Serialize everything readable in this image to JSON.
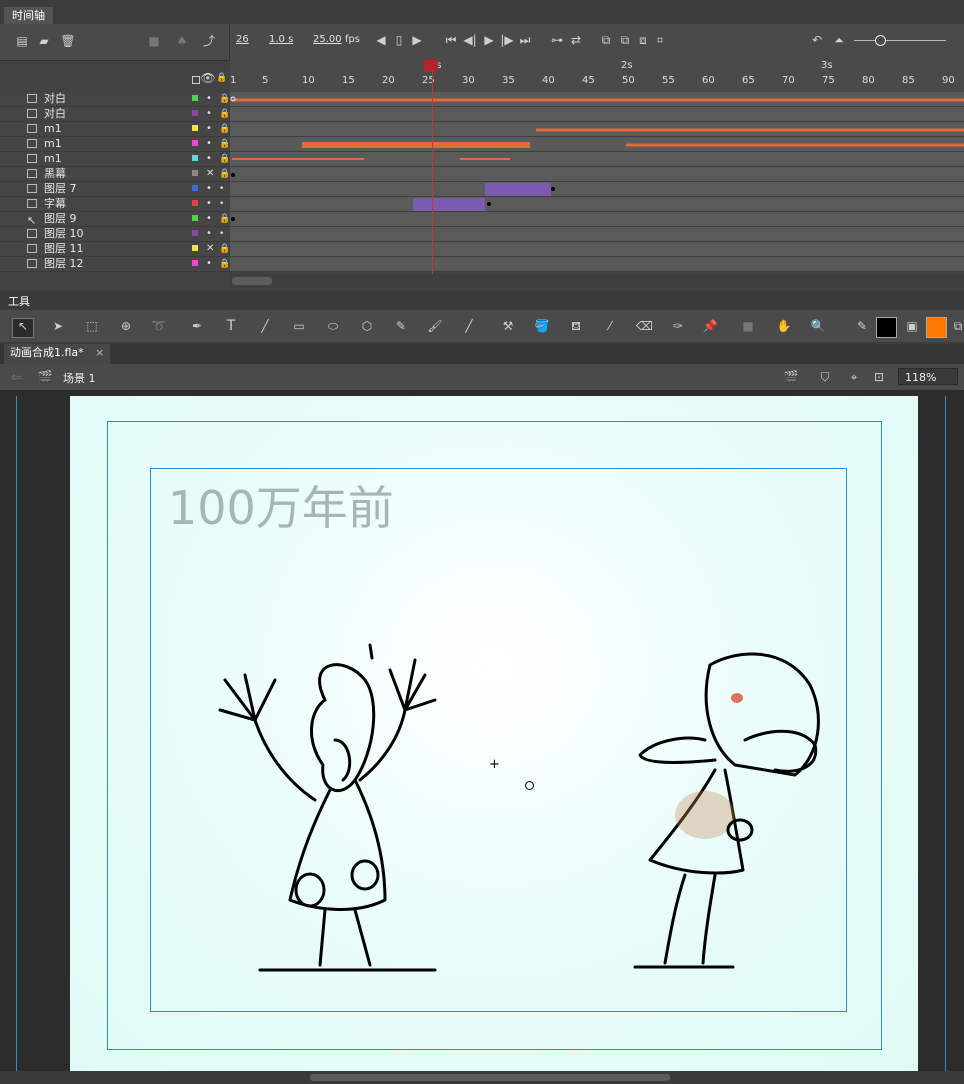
{
  "timeline": {
    "panel_title": "时间轴",
    "current_frame": "26",
    "elapsed": "1.0 s",
    "fps_value": "25.00",
    "fps_unit": "fps",
    "ruler_ticks": [
      "1",
      "5",
      "10",
      "15",
      "20",
      "25",
      "30",
      "35",
      "40",
      "45",
      "50",
      "55",
      "60",
      "65",
      "70",
      "75",
      "80",
      "85",
      "90"
    ],
    "seconds_marks": [
      "1s",
      "2s",
      "3s"
    ],
    "layers": [
      {
        "name": "对白",
        "color": "#4cd44c",
        "visible": "•",
        "lock": "🔒"
      },
      {
        "name": "对白",
        "color": "#8e44ad",
        "visible": "•",
        "lock": "🔒"
      },
      {
        "name": "m1",
        "color": "#f1e44a",
        "visible": "•",
        "lock": "🔒"
      },
      {
        "name": "m1",
        "color": "#e84ad4",
        "visible": "•",
        "lock": "🔒"
      },
      {
        "name": "m1",
        "color": "#4ae0e0",
        "visible": "•",
        "lock": "🔒"
      },
      {
        "name": "黑幕",
        "color": "#888888",
        "visible": "✕",
        "lock": "🔒"
      },
      {
        "name": "图层 7",
        "color": "#3a6fd8",
        "visible": "•",
        "lock": "•"
      },
      {
        "name": "字幕",
        "color": "#e04444",
        "visible": "•",
        "lock": "•"
      },
      {
        "name": "图层 9",
        "color": "#4cd44c",
        "visible": "•",
        "lock": "🔒"
      },
      {
        "name": "图层 10",
        "color": "#8e44ad",
        "visible": "•",
        "lock": "•"
      },
      {
        "name": "图层 11",
        "color": "#f1e44a",
        "visible": "✕",
        "lock": "🔒"
      },
      {
        "name": "图层 12",
        "color": "#e84ad4",
        "visible": "•",
        "lock": "🔒"
      }
    ]
  },
  "tools": {
    "panel_title": "工具"
  },
  "document": {
    "tab_label": "动画合成1.fla*",
    "close": "×",
    "scene_label": "场景 1",
    "zoom": "118%",
    "stage_text": "100万年前"
  },
  "colors": {
    "stroke": "#000000",
    "fill": "#ff7a00",
    "accent": "#2a8fd0",
    "playhead": "#c0392b",
    "waveform": "#e06a3a",
    "tween": "#7a5bb0"
  }
}
